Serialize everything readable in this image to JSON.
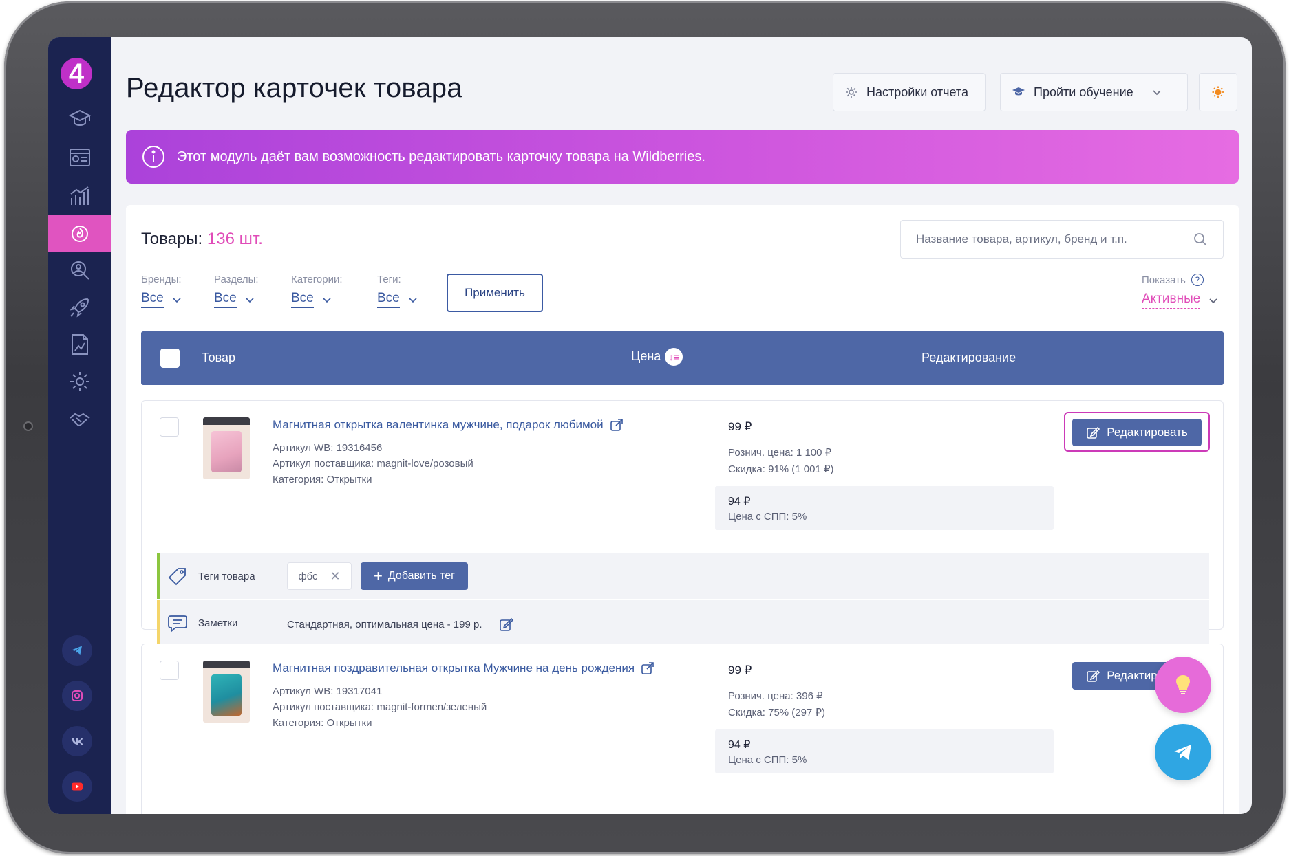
{
  "app": {
    "logo_text": "4"
  },
  "header": {
    "title": "Редактор карточек товара",
    "report_settings_label": "Настройки отчета",
    "training_label": "Пройти обучение"
  },
  "banner": {
    "text": "Этот модуль даёт вам возможность редактировать карточку товара на Wildberries."
  },
  "products_header": {
    "label": "Товары:",
    "count": "136 шт."
  },
  "search": {
    "placeholder": "Название товара, артикул, бренд и т.п."
  },
  "filters": [
    {
      "label": "Бренды:",
      "value": "Все"
    },
    {
      "label": "Разделы:",
      "value": "Все"
    },
    {
      "label": "Категории:",
      "value": "Все"
    },
    {
      "label": "Теги:",
      "value": "Все"
    }
  ],
  "apply_label": "Применить",
  "show": {
    "label": "Показать",
    "help": "?",
    "value": "Активные"
  },
  "table": {
    "col_product": "Товар",
    "col_price": "Цена",
    "col_edit": "Редактирование"
  },
  "products": [
    {
      "title": "Магнитная открытка валентинка мужчине, подарок любимой",
      "article_wb": "Артикул WB: 19316456",
      "article_supplier": "Артикул поставщика: magnit-love/розовый",
      "category": "Категория: Открытки",
      "price": "99 ₽",
      "retail_price": "Рознич. цена: 1 100 ₽",
      "discount": "Скидка: 91% (1 001 ₽)",
      "spp_price": "94 ₽",
      "spp_label": "Цена с СПП: 5%",
      "edit_label": "Редактировать",
      "tags_label": "Теги товара",
      "tags": [
        "фбс"
      ],
      "add_tag_label": "Добавить тег",
      "notes_label": "Заметки",
      "note": "Стандартная, оптимальная цена - 199 р."
    },
    {
      "title": "Магнитная поздравительная открытка Мужчине на день рождения",
      "article_wb": "Артикул WB: 19317041",
      "article_supplier": "Артикул поставщика: magnit-formen/зеленый",
      "category": "Категория: Открытки",
      "price": "99 ₽",
      "retail_price": "Рознич. цена: 396 ₽",
      "discount": "Скидка: 75% (297 ₽)",
      "spp_price": "94 ₽",
      "spp_label": "Цена с СПП: 5%",
      "edit_label": "Редактировать"
    }
  ],
  "colors": {
    "sidebar": "#1b2350",
    "accent_pink": "#e054c0",
    "primary_blue": "#4e67a6",
    "banner_start": "#ab42da",
    "banner_end": "#e66ce2"
  },
  "icons": {
    "sidebar": [
      "graduation-cap-icon",
      "dashboard-icon",
      "analytics-icon",
      "fire-icon",
      "search-person-icon",
      "rocket-icon",
      "report-icon",
      "gear-icon",
      "handshake-icon"
    ],
    "social": [
      "telegram-icon",
      "instagram-icon",
      "vk-icon",
      "youtube-icon"
    ]
  }
}
